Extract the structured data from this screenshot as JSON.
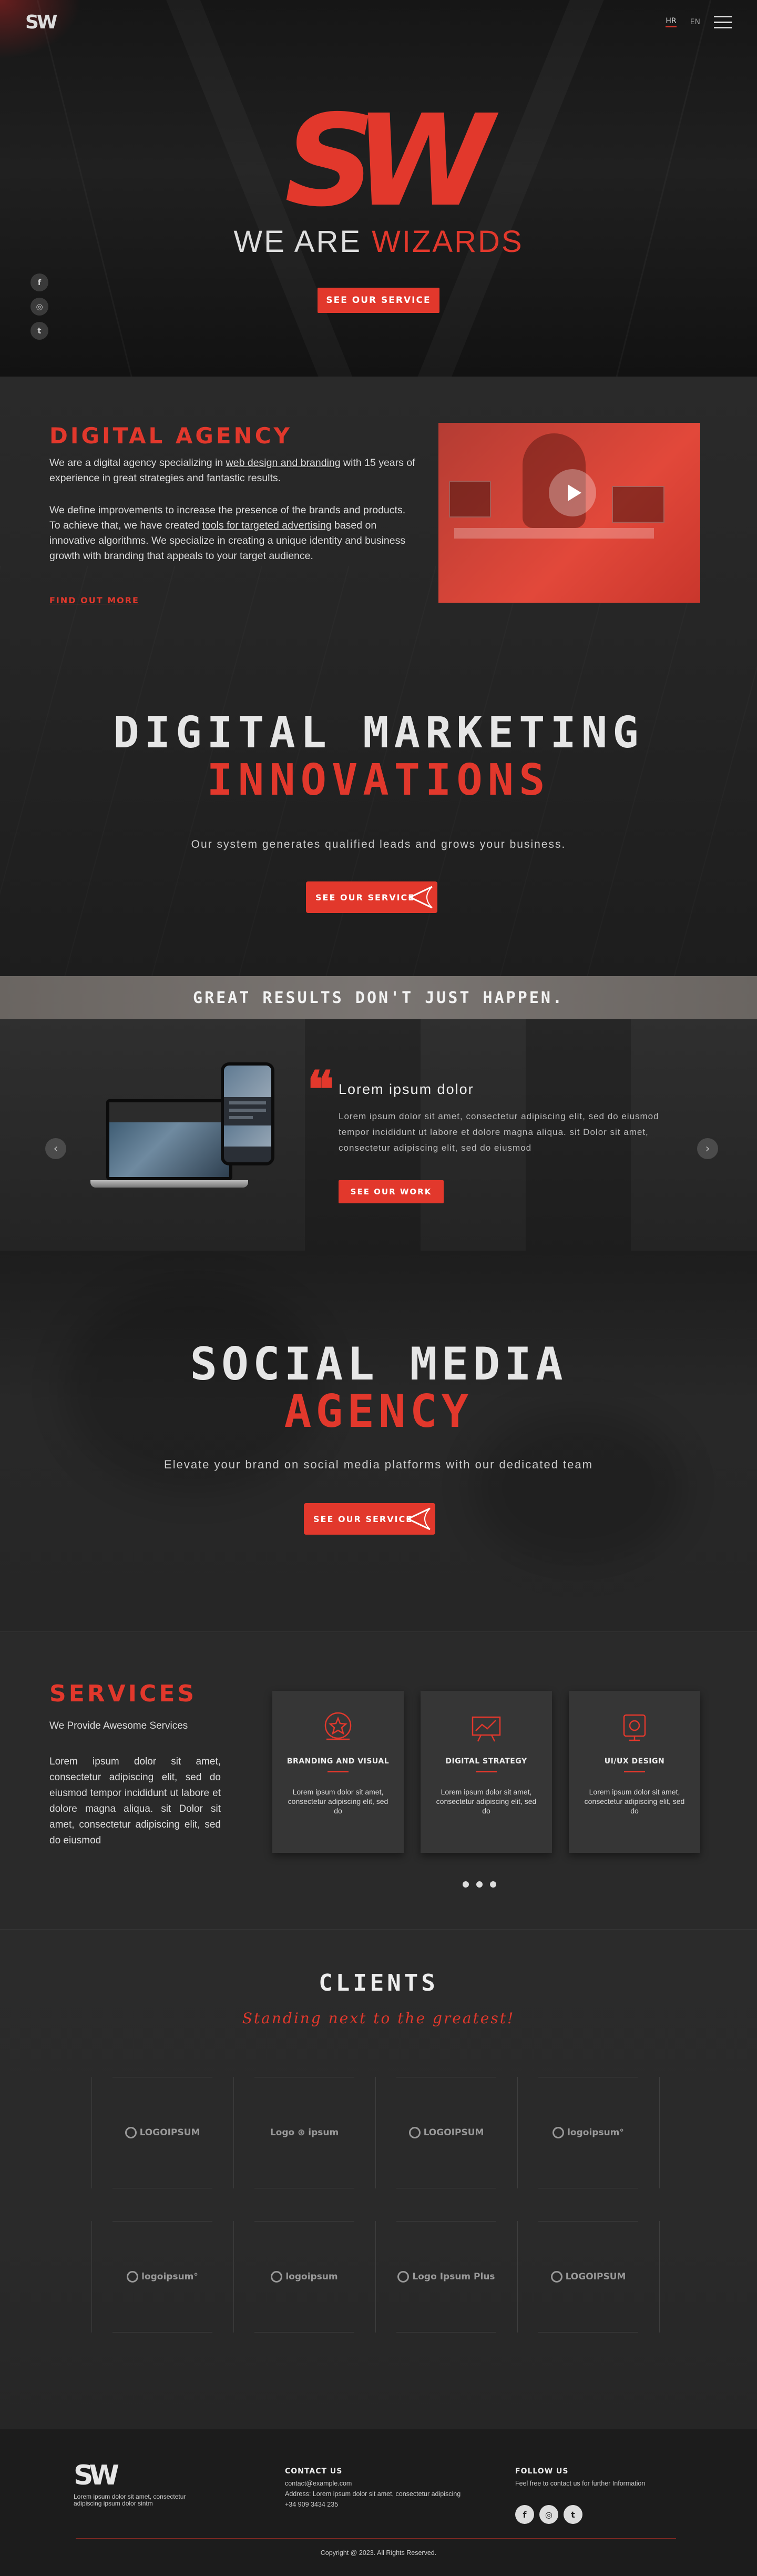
{
  "header": {
    "logo": "SW",
    "lang_hr": "HR",
    "lang_en": "EN"
  },
  "hero": {
    "big_logo": "SW",
    "tagline_prefix": "WE ARE ",
    "tagline_accent": "WIZARDS",
    "button": "SEE OUR SERVICE",
    "socials": [
      "f",
      "◎",
      "t"
    ]
  },
  "agency": {
    "title": "DIGITAL AGENCY",
    "p1_a": "We are a digital agency specializing in ",
    "p1_link": "web design and branding",
    "p1_b": " with 15 years of experience in great strategies and fantastic results.",
    "p2_a": "We define improvements to increase the presence of the brands and products. To achieve that, we have created ",
    "p2_link": "tools for targeted advertising",
    "p2_b": " based on innovative algorithms. We specialize in creating a unique identity and business growth with branding that appeals to your target audience.",
    "find_out_more": "FIND OUT MORE"
  },
  "marketing": {
    "line1": "DIGITAL MARKETING",
    "line2": "INNOVATIONS",
    "subtitle": "Our system generates qualified leads and grows your business.",
    "button": "SEE OUR SERVICE"
  },
  "banner": {
    "text": "GREAT RESULTS DON'T JUST HAPPEN."
  },
  "carousel": {
    "quote_mark": "❝",
    "title": "Lorem ipsum dolor",
    "text": "Lorem ipsum dolor sit amet, consectetur adipiscing elit, sed do eiusmod tempor incididunt ut labore et dolore magna aliqua. sit Dolor sit amet, consectetur adipiscing elit, sed do eiusmod",
    "button": "SEE OUR WORK",
    "prev": "‹",
    "next": "›"
  },
  "social": {
    "line1": "SOCIAL MEDIA",
    "line2": "AGENCY",
    "subtitle": "Elevate your brand on social media platforms with our dedicated team",
    "button": "SEE OUR SERVICE"
  },
  "services": {
    "title": "SERVICES",
    "subtitle": "We Provide Awesome Services",
    "text": "Lorem ipsum dolor sit amet, consectetur adipiscing elit, sed do eiusmod tempor incididunt ut labore et dolore magna aliqua. sit Dolor sit amet, consectetur adipiscing elit, sed do eiusmod",
    "cards": [
      {
        "title": "BRANDING AND VISUAL",
        "text": "Lorem ipsum dolor sit amet, consectetur adipiscing elit, sed do",
        "icon": "star-badge-icon"
      },
      {
        "title": "DIGITAL STRATEGY",
        "text": "Lorem ipsum dolor sit amet, consectetur adipiscing elit, sed do",
        "icon": "strategy-board-icon"
      },
      {
        "title": "UI/UX DESIGN",
        "text": "Lorem ipsum dolor sit amet, consectetur adipiscing elit, sed do",
        "icon": "design-tools-icon"
      }
    ]
  },
  "clients": {
    "title": "CLIENTS",
    "subtitle": "Standing next to the greatest!",
    "logos": [
      "LOGOIPSUM",
      "Logo ⊛ ipsum",
      "LOGOIPSUM",
      "logoipsum°",
      "logoipsum°",
      "logoipsum",
      "Logo Ipsum Plus",
      "LOGOIPSUM"
    ]
  },
  "footer": {
    "logo": "SW",
    "description": "Lorem ipsum dolor sit amet, consectetur adipiscing ipsum dolor sintm",
    "contact_heading": "CONTACT US",
    "email": "contact@example.com",
    "address": "Address: Lorem ipsum dolor sit amet, consectetur adipiscing",
    "phone": "+34 909 3434 235",
    "follow_heading": "FOLLOW US",
    "follow_text": "Feel free to contact us for further Information",
    "copyright": "Copyright @ 2023. All Rights Reserved."
  },
  "colors": {
    "accent": "#e2382c",
    "background": "#1c1c1c"
  }
}
